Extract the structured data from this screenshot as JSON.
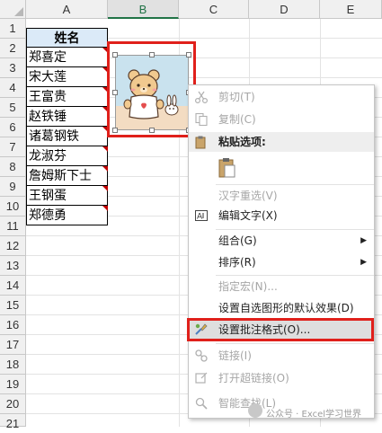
{
  "columns": [
    "A",
    "B",
    "C",
    "D",
    "E"
  ],
  "rows": [
    "1",
    "2",
    "3",
    "4",
    "5",
    "6",
    "7",
    "8",
    "9",
    "10",
    "11",
    "12",
    "13",
    "14",
    "15",
    "16",
    "17",
    "18",
    "19",
    "20",
    "21"
  ],
  "sheet": {
    "header": "姓名",
    "names": [
      "郑喜定",
      "宋大莲",
      "王富贵",
      "赵铁锤",
      "诸葛钢铁",
      "龙淑芬",
      "詹姆斯下士",
      "王钢蛋",
      "郑德勇"
    ]
  },
  "context_menu": {
    "cut": "剪切(T)",
    "copy": "复制(C)",
    "paste_options": "粘贴选项:",
    "reconvert": "汉字重选(V)",
    "edit_text": "编辑文字(X)",
    "group": "组合(G)",
    "order": "排序(R)",
    "assign_macro": "指定宏(N)...",
    "set_default": "设置自选图形的默认效果(D)",
    "format_comment": "设置批注格式(O)...",
    "link": "链接(I)",
    "open_hyperlink": "打开超链接(O)",
    "smart_lookup": "智能查找(L)"
  },
  "watermark": "公众号 · Excel学习世界",
  "colors": {
    "header_fill": "#dbeaf8",
    "highlight_red": "#e0201b",
    "comment_indicator": "#c00000",
    "selected_col_accent": "#217346"
  }
}
